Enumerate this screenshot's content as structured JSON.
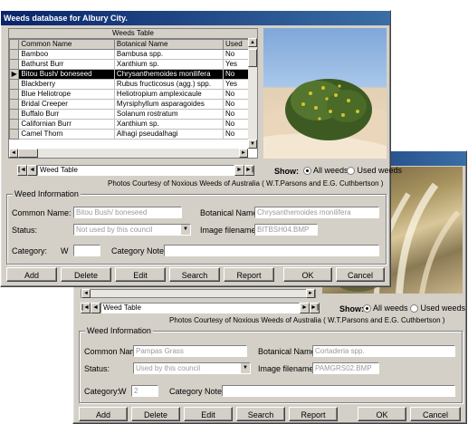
{
  "front": {
    "title": "Weeds database for Albury City.",
    "table_caption": "Weeds Table",
    "columns": [
      "Common Name",
      "Botanical Name",
      "Used"
    ],
    "rows": [
      {
        "common": "Bamboo",
        "botanical": "Bambusa spp.",
        "used": "No"
      },
      {
        "common": "Bathurst Burr",
        "botanical": "Xanthium sp.",
        "used": "Yes"
      },
      {
        "common": "Bitou Bush/ boneseed",
        "botanical": "Chrysanthemoides monilifera",
        "used": "No",
        "current": true
      },
      {
        "common": "Blackberry",
        "botanical": "Rubus fructicosus (agg.) spp.",
        "used": "Yes"
      },
      {
        "common": "Blue Heliotrope",
        "botanical": "Heliotropium amplexicaule",
        "used": "No"
      },
      {
        "common": "Bridal Creeper",
        "botanical": "Myrsiphyllum asparagoides",
        "used": "No"
      },
      {
        "common": "Buffalo Burr",
        "botanical": "Solanum rostratum",
        "used": "No"
      },
      {
        "common": "Californian Burr",
        "botanical": "Xanthium sp.",
        "used": "No"
      },
      {
        "common": "Camel Thorn",
        "botanical": "Alhagi pseudalhagi",
        "used": "No"
      }
    ],
    "nav_label": "Weed Table",
    "show_label": "Show:",
    "radio_all": "All weeds",
    "radio_used": "Used weeds",
    "credit": "Photos Courtesy of Noxious Weeds of Australia ( W.T.Parsons and E.G. Cuthbertson )",
    "group_title": "Weed Information",
    "common_name_label": "Common Name:",
    "common_name_value": "Bitou Bush/ boneseed",
    "botanical_label": "Botanical Name:",
    "botanical_value": "Chrysanthemoides monilifera",
    "status_label": "Status:",
    "status_value": "Not used by this council",
    "image_label": "Image filename:",
    "image_value": "BITBSH04.BMP",
    "category_label": "Category:",
    "category_prefix": "W",
    "category_value": "",
    "category_note_label": "Category Note:",
    "buttons": {
      "add": "Add",
      "delete": "Delete",
      "edit": "Edit",
      "search": "Search",
      "report": "Report",
      "ok": "OK",
      "cancel": "Cancel"
    }
  },
  "back": {
    "nav_label": "Weed Table",
    "show_label": "Show:",
    "radio_all": "All weeds",
    "radio_used": "Used weeds",
    "credit": "Photos Courtesy of Noxious Weeds of Australia ( W.T.Parsons and E.G. Cuthbertson )",
    "group_title": "Weed Information",
    "common_name_label": "Common Name:",
    "common_name_value": "Pampas Grass",
    "botanical_label": "Botanical Name:",
    "botanical_value": "Cortaderia spp.",
    "status_label": "Status:",
    "status_value": "Used by this council",
    "image_label": "Image filename:",
    "image_value": "PAMGRS02.BMP",
    "category_label": "Category:",
    "category_prefix": "W",
    "category_value": "2",
    "category_note_label": "Category Note:",
    "buttons": {
      "add": "Add",
      "delete": "Delete",
      "edit": "Edit",
      "search": "Search",
      "report": "Report",
      "ok": "OK",
      "cancel": "Cancel"
    }
  },
  "colors": {
    "title_bar": "#0a246a",
    "window_face": "#d4d0c8",
    "selection": "#000000"
  }
}
